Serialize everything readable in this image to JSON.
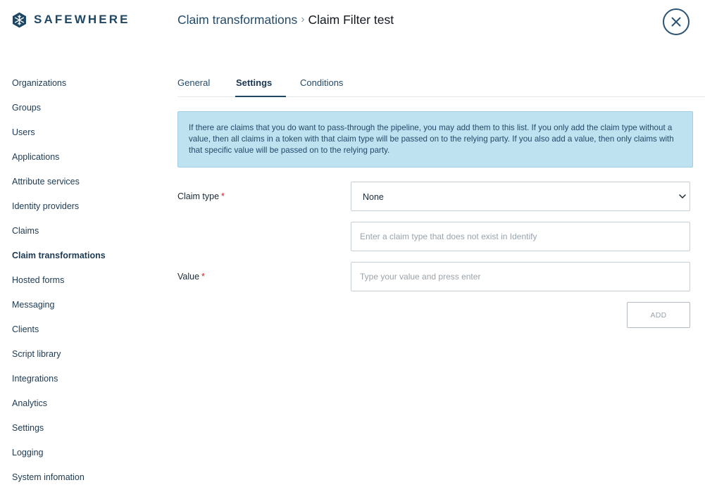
{
  "brand": {
    "name": "SAFEWHERE",
    "icon": "snowflake-logo-icon",
    "color": "#1f4763"
  },
  "breadcrumb": {
    "parent": "Claim transformations",
    "separator": "›",
    "current": "Claim Filter test"
  },
  "close": {
    "icon": "close-icon"
  },
  "sidebar": {
    "items": [
      {
        "label": "Organizations"
      },
      {
        "label": "Groups"
      },
      {
        "label": "Users"
      },
      {
        "label": "Applications"
      },
      {
        "label": "Attribute services"
      },
      {
        "label": "Identity providers"
      },
      {
        "label": "Claims"
      },
      {
        "label": "Claim transformations",
        "active": true
      },
      {
        "label": "Hosted forms"
      },
      {
        "label": "Messaging"
      },
      {
        "label": "Clients"
      },
      {
        "label": "Script library"
      },
      {
        "label": "Integrations"
      },
      {
        "label": "Analytics"
      },
      {
        "label": "Settings"
      },
      {
        "label": "Logging"
      },
      {
        "label": "System infomation"
      }
    ]
  },
  "tabs": [
    {
      "label": "General"
    },
    {
      "label": "Settings",
      "active": true
    },
    {
      "label": "Conditions"
    }
  ],
  "info": {
    "text": "If there are claims that you do want to pass-through the pipeline, you may add them to this list. If you only add the claim type without a value, then all claims in a token with that claim type will be passed on to the relying party. If you also add a value, then only claims with that specific value will be passed on to the relying party."
  },
  "form": {
    "claim_type_label": "Claim type",
    "required_marker": "*",
    "claim_type_selected": "None",
    "custom_claim_placeholder": "Enter a claim type that does not exist in Identify",
    "value_label": "Value",
    "value_placeholder": "Type your value and press enter",
    "add_label": "ADD"
  },
  "colors": {
    "info_bg": "#bfe2f1",
    "required": "#d0242e",
    "accent": "#1f4763"
  }
}
